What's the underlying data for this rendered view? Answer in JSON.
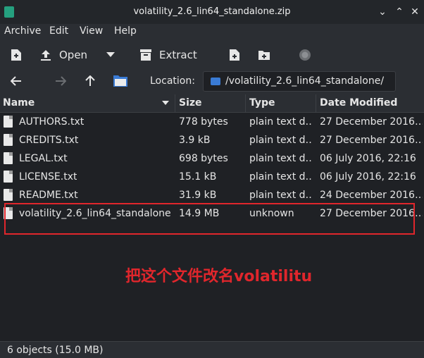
{
  "window": {
    "title": "volatility_2.6_lin64_standalone.zip",
    "controls": [
      "⌄",
      "⌃",
      "✕"
    ]
  },
  "menu": [
    "Archive",
    "Edit",
    "View",
    "Help"
  ],
  "toolbar": {
    "open_label": "Open",
    "extract_label": "Extract"
  },
  "location": {
    "label": "Location:",
    "path": "/volatility_2.6_lin64_standalone/"
  },
  "columns": [
    "Name",
    "Size",
    "Type",
    "Date Modified"
  ],
  "files": [
    {
      "name": "AUTHORS.txt",
      "size": "778 bytes",
      "type": "plain text d…",
      "date": "27 December 2016…"
    },
    {
      "name": "CREDITS.txt",
      "size": "3.9 kB",
      "type": "plain text d…",
      "date": "27 December 2016…"
    },
    {
      "name": "LEGAL.txt",
      "size": "698 bytes",
      "type": "plain text d…",
      "date": "06 July 2016, 22:16"
    },
    {
      "name": "LICENSE.txt",
      "size": "15.1 kB",
      "type": "plain text d…",
      "date": "06 July 2016, 22:16"
    },
    {
      "name": "README.txt",
      "size": "31.9 kB",
      "type": "plain text d…",
      "date": "24 December 2016…"
    },
    {
      "name": "volatility_2.6_lin64_standalone",
      "size": "14.9 MB",
      "type": "unknown",
      "date": "27 December 2016…"
    }
  ],
  "annotation": "把这个文件改名volatilitu",
  "status": "6 objects (15.0 MB)",
  "colors": {
    "highlight": "#e0262c",
    "folder_blue": "#3a7bd5",
    "app_icon": "#25a07f"
  }
}
